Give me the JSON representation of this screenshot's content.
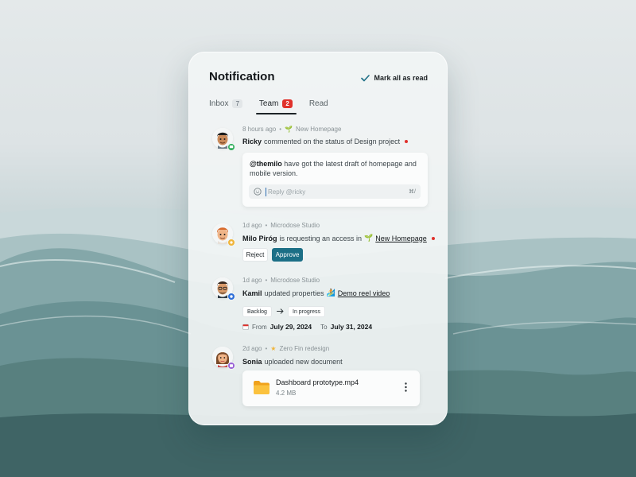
{
  "header": {
    "title": "Notification",
    "mark_all_label": "Mark all as read"
  },
  "tabs": [
    {
      "label": "Inbox",
      "count": "7"
    },
    {
      "label": "Team",
      "count": "2",
      "active": true
    },
    {
      "label": "Read"
    }
  ],
  "colors": {
    "accent": "#1c6f86",
    "unread": "#e0312b",
    "online": "#2fae5a",
    "reaction": "#f0b53a",
    "edit": "#2d6ed8",
    "upload": "#9a62d6"
  },
  "notifications": [
    {
      "time": "8 hours ago",
      "project": "New Homepage",
      "user": "Ricky",
      "action": "commented on the status of Design project",
      "comment": {
        "mention": "@themilo",
        "text": "have got the latest draft of homepage and mobile version."
      },
      "reply_placeholder": "Reply @ricky",
      "reply_shortcut": "⌘/"
    },
    {
      "time": "1d ago",
      "project": "Microdose Studio",
      "user": "Milo Piróg",
      "action": "is requesting an access in",
      "link": "New Homepage",
      "reject_label": "Reject",
      "approve_label": "Approve"
    },
    {
      "time": "1d ago",
      "project": "Microdose Studio",
      "user": "Kamil",
      "action": "updated properties",
      "link": "Demo reel video",
      "from_status": "Backlog",
      "to_status": "In progress",
      "from_label": "From",
      "from_date": "July 29, 2024",
      "to_label": "To",
      "to_date": "July 31, 2024"
    },
    {
      "time": "2d ago",
      "project": "Zero Fin redesign",
      "user": "Sonia",
      "action": "uploaded new document",
      "file_name": "Dashboard prototype.mp4",
      "file_size": "4.2 MB"
    }
  ]
}
